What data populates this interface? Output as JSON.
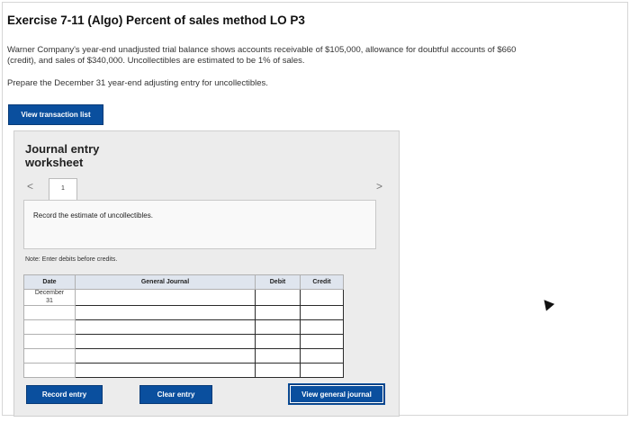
{
  "exercise": {
    "title": "Exercise 7-11 (Algo) Percent of sales method LO P3",
    "description": "Warner Company's year-end unadjusted trial balance shows accounts receivable of $105,000, allowance for doubtful accounts of $660 (credit), and sales of $340,000. Uncollectibles are estimated to be 1% of sales.",
    "task": "Prepare the December 31 year-end adjusting entry for uncollectibles."
  },
  "buttons": {
    "view_transaction_list": "View transaction list",
    "record_entry": "Record entry",
    "clear_entry": "Clear entry",
    "view_general_journal": "View general journal"
  },
  "worksheet": {
    "title": "Journal entry worksheet",
    "nav_prev": "<",
    "nav_next": ">",
    "tab_number": "1",
    "instruction": "Record the estimate of uncollectibles.",
    "note": "Note: Enter debits before credits."
  },
  "journal_table": {
    "headers": {
      "date": "Date",
      "general_journal": "General Journal",
      "debit": "Debit",
      "credit": "Credit"
    },
    "date_month": "December",
    "date_day": "31",
    "row_count": 6
  }
}
